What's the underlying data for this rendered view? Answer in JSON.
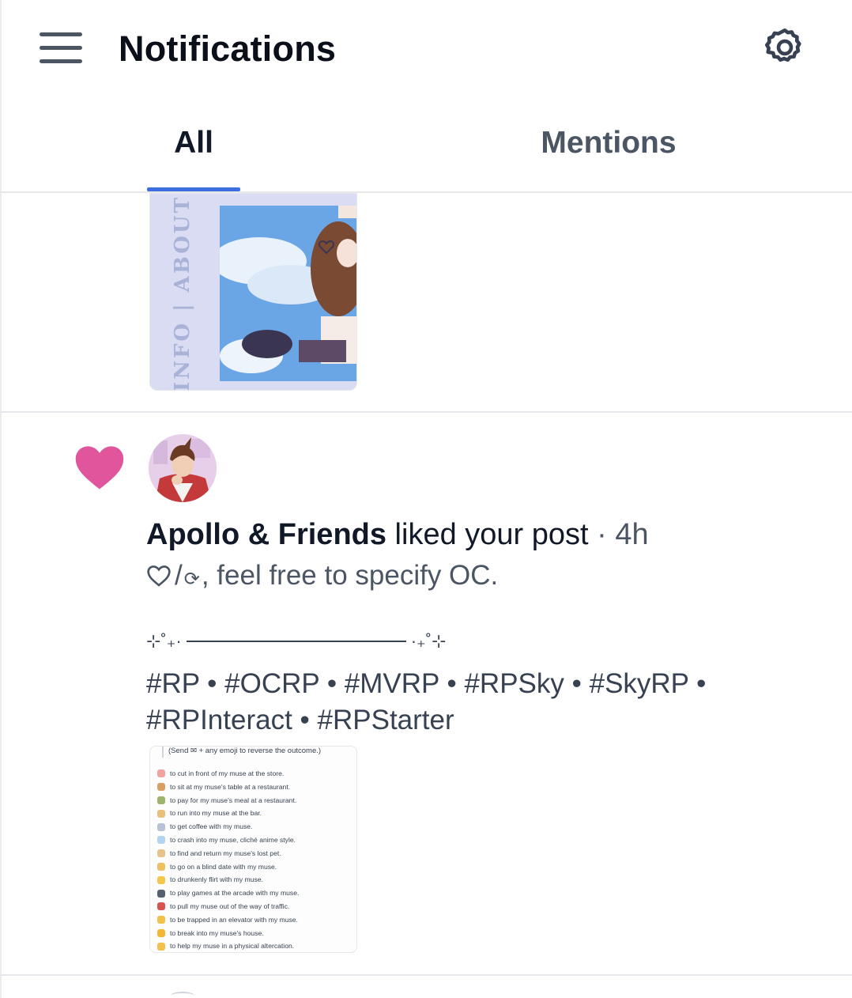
{
  "header": {
    "title": "Notifications",
    "menu_icon": "hamburger-menu-icon",
    "settings_icon": "gear-icon"
  },
  "tabs": [
    {
      "label": "All",
      "active": true
    },
    {
      "label": "Mentions",
      "active": false
    }
  ],
  "previous_item": {
    "image_text": "INFO | ABOUT"
  },
  "notification": {
    "icon": "heart-icon",
    "icon_color": "#e0559c",
    "actor": "Apollo & Friends",
    "action": " liked your post",
    "separator": " · ",
    "time": "4h",
    "post_line1_rest": ", feel free to specify OC.",
    "post_line1_slash": "/",
    "sparkle_left": "⊹˚₊·",
    "sparkle_right": "·₊˚⊹",
    "hashtags": "#RP • #OCRP • #MVRP •  #RPSky • #SkyRP • #RPInteract • #RPStarter",
    "preview": {
      "header": "(Send ✉ + any emoji to reverse the outcome.)",
      "items": [
        "to cut in front of my muse at the store.",
        "to sit at my muse's table at a restaurant.",
        "to pay for my muse's meal at a restaurant.",
        "to run into my muse at the bar.",
        "to get coffee with my muse.",
        "to crash into my muse, cliché anime style.",
        "to find and return my muse's lost pet.",
        "to go on a blind date with my muse.",
        "to drunkenly flirt with my muse.",
        "to play games at the arcade with my muse.",
        "to pull my muse out of the way of traffic.",
        "to be trapped in an elevator with my muse.",
        "to break into my muse's house.",
        "to help my muse in a physical altercation."
      ]
    }
  },
  "colors": {
    "accent": "#3b6fe0",
    "heart": "#e0559c",
    "muted_text": "#4b5563"
  }
}
